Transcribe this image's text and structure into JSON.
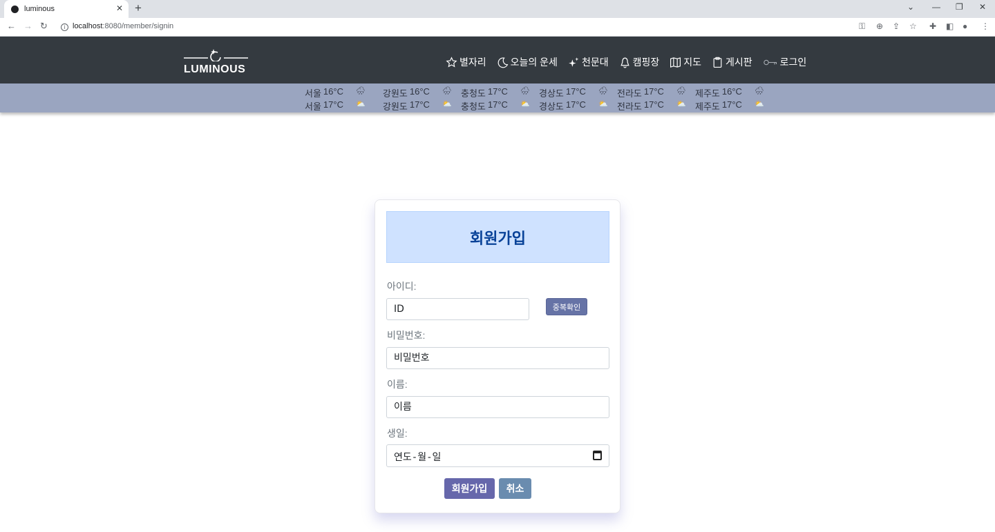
{
  "browser": {
    "tab_title": "luminous",
    "url_host": "localhost",
    "url_rest": ":8080/member/signin"
  },
  "header": {
    "logo_text": "LUMINOUS",
    "menu": [
      {
        "label": "별자리",
        "icon": "star-icon"
      },
      {
        "label": "오늘의 운세",
        "icon": "moon-icon"
      },
      {
        "label": "천문대",
        "icon": "sparkles-icon"
      },
      {
        "label": "캠핑장",
        "icon": "bell-icon"
      },
      {
        "label": "지도",
        "icon": "map-icon"
      },
      {
        "label": "게시판",
        "icon": "clipboard-icon"
      },
      {
        "label": "로그인",
        "icon": "key-icon"
      }
    ]
  },
  "weather": {
    "row1": [
      {
        "city": "서울",
        "temp": "16°C",
        "icon": "cloud-rain-icon"
      },
      {
        "city": "강원도",
        "temp": "16°C",
        "icon": "cloud-rain-icon"
      },
      {
        "city": "충청도",
        "temp": "17°C",
        "icon": "cloud-rain-icon"
      },
      {
        "city": "경상도",
        "temp": "17°C",
        "icon": "cloud-rain-icon"
      },
      {
        "city": "전라도",
        "temp": "17°C",
        "icon": "cloud-rain-icon"
      },
      {
        "city": "제주도",
        "temp": "16°C",
        "icon": "cloud-rain-icon"
      }
    ],
    "row2": [
      {
        "city": "서울",
        "temp": "17°C",
        "icon": "sun-cloud-icon"
      },
      {
        "city": "강원도",
        "temp": "17°C",
        "icon": "sun-cloud-icon"
      },
      {
        "city": "충청도",
        "temp": "17°C",
        "icon": "sun-cloud-icon"
      },
      {
        "city": "경상도",
        "temp": "17°C",
        "icon": "sun-cloud-icon"
      },
      {
        "city": "전라도",
        "temp": "17°C",
        "icon": "sun-cloud-icon"
      },
      {
        "city": "제주도",
        "temp": "17°C",
        "icon": "sun-cloud-icon"
      }
    ]
  },
  "form": {
    "title": "회원가입",
    "id_label": "아이디:",
    "id_placeholder": "ID",
    "dup_check": "중복확인",
    "password_label": "비밀번호:",
    "password_placeholder": "비밀번호",
    "name_label": "이름:",
    "name_placeholder": "이름",
    "birth_label": "생일:",
    "birth_placeholder": "연도-월-일",
    "submit": "회원가입",
    "cancel": "취소"
  },
  "colors": {
    "header_bg": "#343a40",
    "weather_bg": "#9aa5c0",
    "title_box_bg": "#cfe2ff",
    "title_text": "#084298",
    "submit_bg": "#6667ab",
    "cancel_bg": "#6a8caf",
    "dup_bg": "#6673a6"
  }
}
